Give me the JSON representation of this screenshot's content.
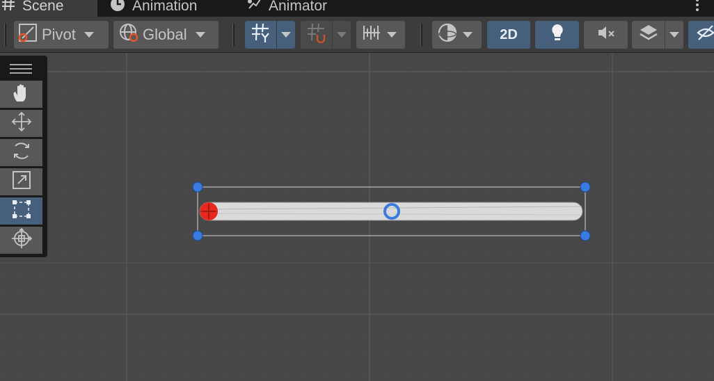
{
  "tabs": [
    {
      "label": "Scene",
      "icon": "hash-icon",
      "active": true
    },
    {
      "label": "Animation",
      "icon": "clock-icon",
      "active": false
    },
    {
      "label": "Animator",
      "icon": "animator-icon",
      "active": false
    }
  ],
  "toolbar": {
    "pivot_label": "Pivot",
    "global_label": "Global",
    "mode_2d_label": "2D"
  },
  "tools": [
    "hand-tool",
    "move-tool",
    "rotate-tool",
    "scale-tool",
    "rect-tool",
    "transform-tool"
  ],
  "selected_tool": "rect-tool",
  "colors": {
    "background": "#474747",
    "accent_blue": "#46607c",
    "handle_blue": "#3a7be0",
    "pivot_red": "#e8281e"
  }
}
